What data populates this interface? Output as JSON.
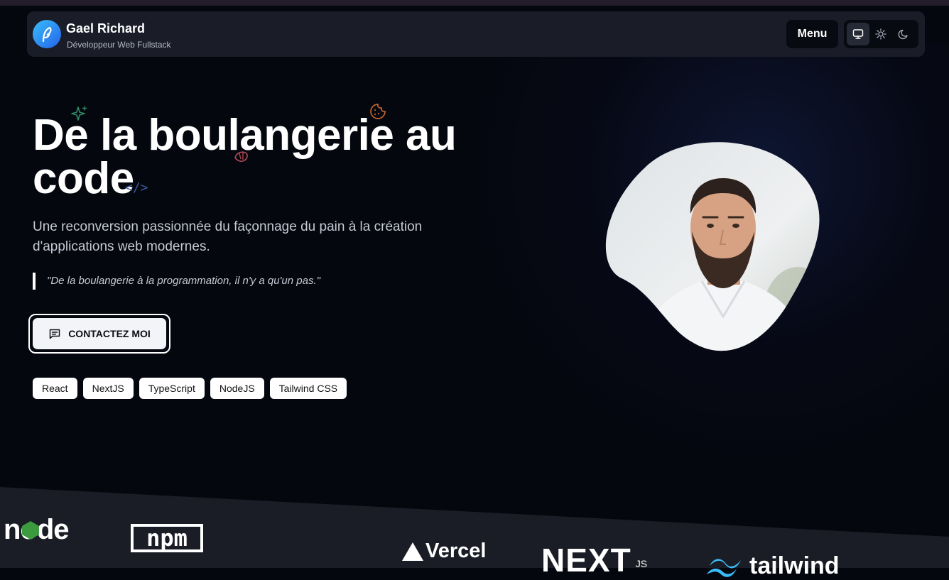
{
  "header": {
    "name": "Gael Richard",
    "subtitle": "Développeur Web Fullstack",
    "menu_label": "Menu",
    "theme_options": [
      "monitor-icon",
      "sun-icon",
      "moon-icon"
    ],
    "active_theme": "monitor"
  },
  "hero": {
    "title_line1": "De la boulangerie au",
    "title_line2": "code",
    "lead": "Une reconversion passionnée du façonnage du pain à la création d'applications web modernes.",
    "quote": "\"De la boulangerie à la programmation, il n'y a qu'un pas.\"",
    "cta_label": "CONTACTEZ MOI",
    "code_deco": "</>"
  },
  "tags": [
    "React",
    "NextJS",
    "TypeScript",
    "NodeJS",
    "Tailwind CSS"
  ],
  "logos": {
    "node": "node",
    "npm": "npm",
    "vercel": "Vercel",
    "next": "NEXT",
    "next_sub": "JS",
    "tailwind": "tailwind"
  },
  "colors": {
    "background": "#05070f",
    "header_bg": "#1a1d28",
    "accent_blue": "#2563eb",
    "sparkle_green": "#2e8a64",
    "cookie_orange": "#c4662a",
    "croissant_red": "#b54a55",
    "tailwind_teal": "#38bdf8"
  }
}
